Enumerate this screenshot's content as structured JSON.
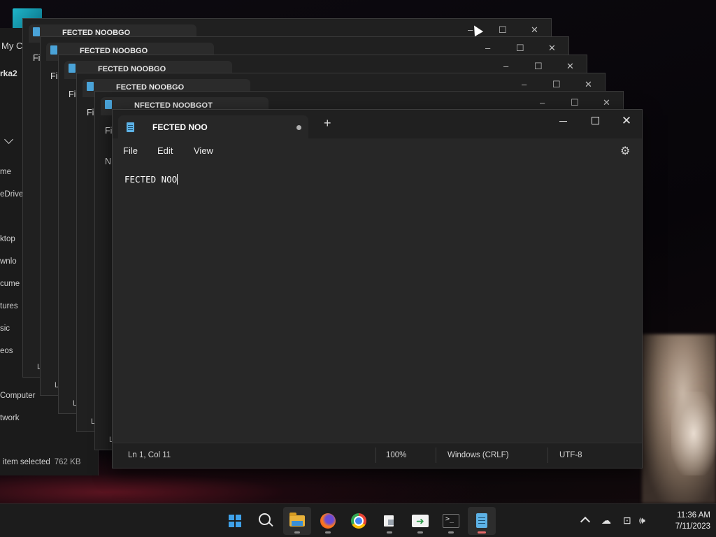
{
  "explorer": {
    "title": "My C",
    "user": "rka2",
    "nav_items": [
      "me",
      "eDrive",
      "ktop",
      "wnlo",
      "cume",
      "tures",
      "sic",
      "eos",
      "Computer",
      "twork"
    ],
    "status_selected": "item selected",
    "status_size": "762 KB"
  },
  "ghost_windows": [
    {
      "tab": "FECTED NOOBGO",
      "menu": "Fi",
      "ln": "L"
    },
    {
      "tab": "FECTED NOOBGO",
      "menu": "Fi",
      "ln": "L"
    },
    {
      "tab": "FECTED NOOBGO",
      "menu": "Fi",
      "ln": "L"
    },
    {
      "tab": "FECTED NOOBGO",
      "menu": "Fi",
      "ln": "L"
    },
    {
      "tab": "NFECTED NOOBGOT",
      "menu": "Fi",
      "ln": "L"
    }
  ],
  "ghost_extra": {
    "n_label": "N"
  },
  "notepad": {
    "tab_title": "FECTED NOO",
    "new_tab": "+",
    "close_glyph": "✕",
    "menu": {
      "file": "File",
      "edit": "Edit",
      "view": "View"
    },
    "content": "FECTED NOO",
    "status": {
      "position": "Ln 1, Col 11",
      "zoom": "100%",
      "line_ending": "Windows (CRLF)",
      "encoding": "UTF-8"
    }
  },
  "taskbar": {
    "apps": [
      "start",
      "search",
      "file-explorer",
      "firefox",
      "chrome",
      "files",
      "run",
      "terminal",
      "notepad"
    ],
    "clock_time": "11:36 AM",
    "clock_date": "7/11/2023"
  },
  "colors": {
    "accent": "#3fa2ea",
    "notepad_icon": "#5db2e6",
    "active_indicator": "#e86a6a"
  }
}
